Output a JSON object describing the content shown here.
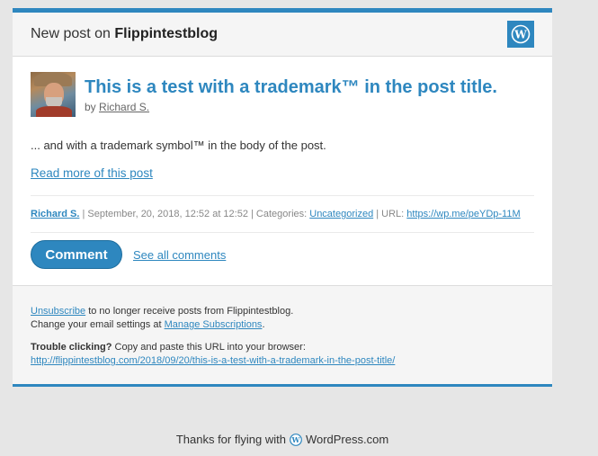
{
  "header": {
    "prefix": "New post on",
    "blog_name": "Flippintestblog",
    "logo_icon": "wordpress-logo-icon"
  },
  "post": {
    "title": "This is a test with a trademark™ in the post title.",
    "by_label": "by",
    "author": "Richard S.",
    "body": "... and with a trademark symbol™ in the body of the post.",
    "read_more": "Read more of this post"
  },
  "meta": {
    "author": "Richard S.",
    "date_text": " | September, 20, 2018, 12:52 at 12:52 | Categories: ",
    "category": "Uncategorized",
    "url_label": " | URL: ",
    "short_url": "https://wp.me/peYDp-11M"
  },
  "actions": {
    "comment": "Comment",
    "see_all": "See all comments"
  },
  "footer": {
    "unsubscribe": "Unsubscribe",
    "unsubscribe_suffix": " to no longer receive posts from Flippintestblog.",
    "change_prefix": "Change your email settings at ",
    "manage": "Manage Subscriptions",
    "period": ".",
    "trouble_bold": "Trouble clicking?",
    "trouble_text": " Copy and paste this URL into your browser:",
    "long_url": "http://flippintestblog.com/2018/09/20/this-is-a-test-with-a-trademark-in-the-post-title/"
  },
  "bottom": {
    "prefix": "Thanks for flying with",
    "brand": "WordPress.com"
  },
  "colors": {
    "accent": "#2e87bf",
    "background": "#e6e6e6"
  }
}
